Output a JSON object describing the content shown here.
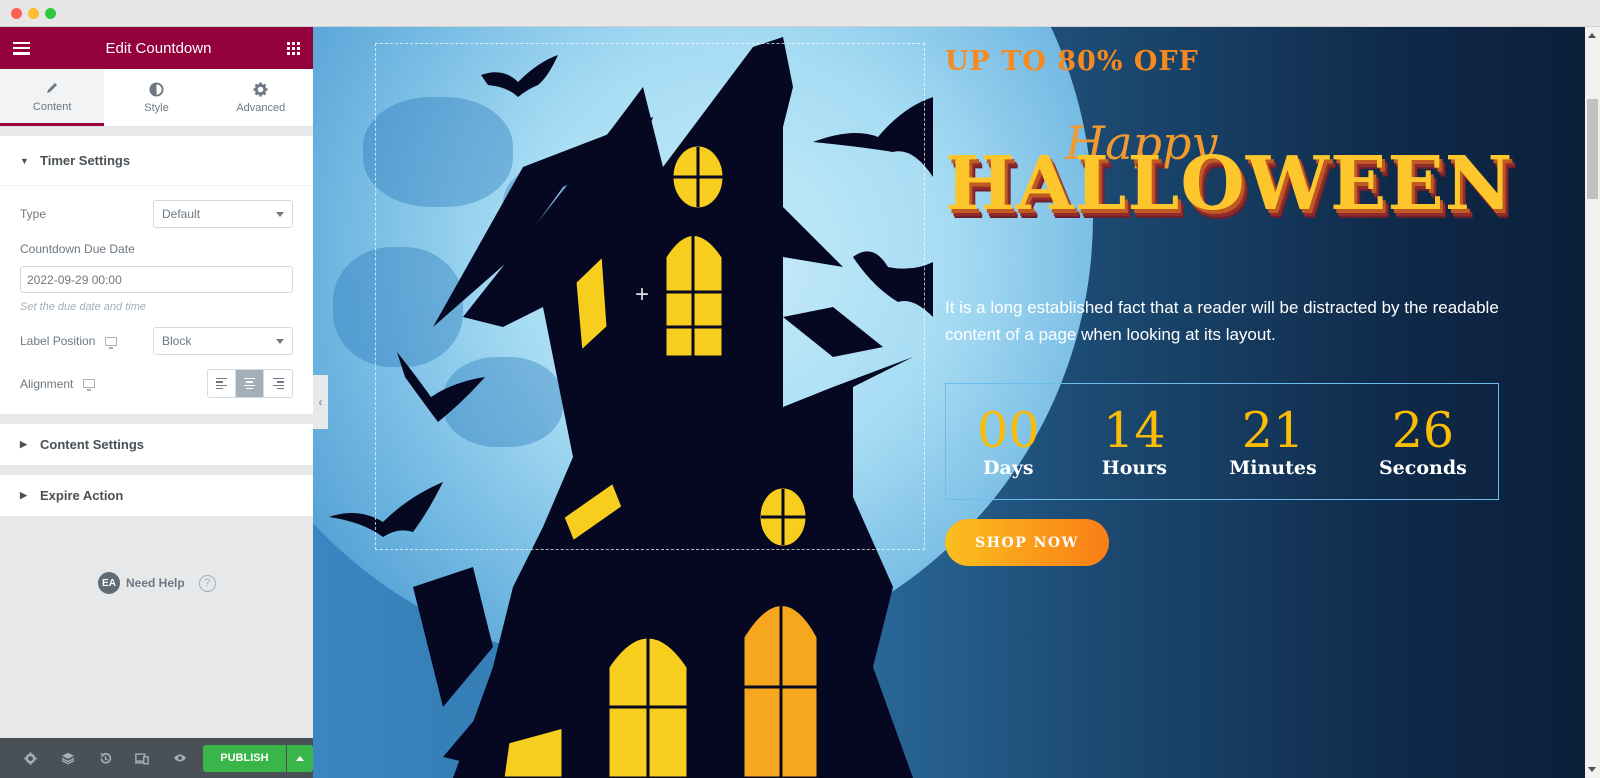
{
  "window": {
    "controls": [
      "close",
      "minimize",
      "maximize"
    ]
  },
  "panel": {
    "title": "Edit Countdown",
    "tabs": [
      {
        "label": "Content",
        "icon": "pencil-icon",
        "active": true
      },
      {
        "label": "Style",
        "icon": "contrast-icon",
        "active": false
      },
      {
        "label": "Advanced",
        "icon": "gear-icon",
        "active": false
      }
    ],
    "timer_settings": {
      "title": "Timer Settings",
      "type_label": "Type",
      "type_value": "Default",
      "due_date_label": "Countdown Due Date",
      "due_date_value": "2022-09-29 00:00",
      "due_date_hint": "Set the due date and time",
      "label_position_label": "Label Position",
      "label_position_value": "Block",
      "alignment_label": "Alignment",
      "alignment_options": [
        "left",
        "center",
        "right"
      ],
      "alignment_selected": "center"
    },
    "content_settings_title": "Content Settings",
    "expire_action_title": "Expire Action",
    "help": {
      "badge": "EA",
      "label": "Need Help",
      "icon": "?"
    },
    "footer": {
      "icons": [
        "settings-icon",
        "layers-icon",
        "history-icon",
        "responsive-icon",
        "preview-icon"
      ],
      "publish_label": "PUBLISH"
    }
  },
  "canvas": {
    "offer": "UP TO 80% OFF",
    "happy": "Happy",
    "halloween": "HALLOWEEN",
    "description": "It is a long established fact that a reader will be distracted by the readable content of a page when looking at its layout.",
    "countdown": [
      {
        "value": "00",
        "label": "Days"
      },
      {
        "value": "14",
        "label": "Hours"
      },
      {
        "value": "21",
        "label": "Minutes"
      },
      {
        "value": "26",
        "label": "Seconds"
      }
    ],
    "shop_button": "SHOP NOW",
    "colors": {
      "accent": "#93003c",
      "countdown_number": "#fbbc04",
      "publish": "#39b54a"
    }
  }
}
